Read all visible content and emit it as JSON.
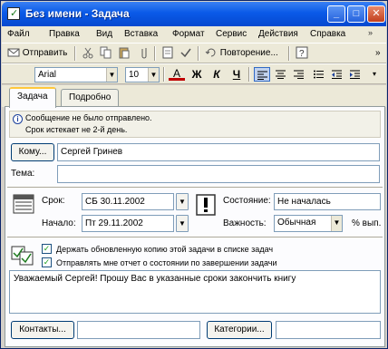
{
  "window": {
    "title": "Без имени - Задача"
  },
  "title_buttons": {
    "minimize": "_",
    "maximize": "□",
    "close": "✕"
  },
  "menu": {
    "items": [
      "Файл",
      "Правка",
      "Вид",
      "Вставка",
      "Формат",
      "Сервис",
      "Действия",
      "Справка"
    ],
    "help_icon": "»"
  },
  "toolbar": {
    "send_label": "Отправить",
    "recurrence_label": "Повторение...",
    "more": "»",
    "icons": [
      "send-icon",
      "cut-icon",
      "copy-icon",
      "paste-icon",
      "attach-icon",
      "recurrence-icon",
      "help-icon"
    ]
  },
  "format": {
    "font": "Arial",
    "size": "10",
    "bold": "Ж",
    "italic": "К",
    "underline": "Ч",
    "font_color": "A",
    "icons": [
      "font-color-icon",
      "align-left-icon",
      "align-center-icon",
      "align-right-icon",
      "bullets-icon",
      "decrease-indent-icon",
      "increase-indent-icon"
    ]
  },
  "tabs": [
    {
      "label": "Задача",
      "active": true
    },
    {
      "label": "Подробно",
      "active": false
    }
  ],
  "info": {
    "line1": "Сообщение не было отправлено.",
    "line2": "Срок истекает не 2-й день."
  },
  "form": {
    "to_button": "Кому...",
    "to_value": "Сергей Гринев",
    "subject_label": "Тема:",
    "subject_value": "",
    "due_label": "Срок:",
    "due_value": "СБ 30.11.2002",
    "start_label": "Начало:",
    "start_value": "Пт 29.11.2002",
    "status_label": "Состояние:",
    "status_value": "Не началась",
    "priority_label": "Важность:",
    "priority_value": "Обычная",
    "percent_label": "% вып."
  },
  "options": {
    "keep_copy": {
      "label": "Держать обновленную копию этой задачи в списке задач",
      "checked": true
    },
    "send_report": {
      "label": "Отправлять мне отчет о состоянии по завершении задачи",
      "checked": true
    }
  },
  "body_text": "Уважаемый Сергей! Прошу Вас в указанные сроки закончить книгу",
  "footer": {
    "contacts_button": "Контакты...",
    "contacts_value": "",
    "categories_button": "Категории...",
    "categories_value": ""
  },
  "colors": {
    "title_bar": "#0a5ae8",
    "window_bg": "#ece9d8",
    "font_color_underline": "#c00000"
  }
}
